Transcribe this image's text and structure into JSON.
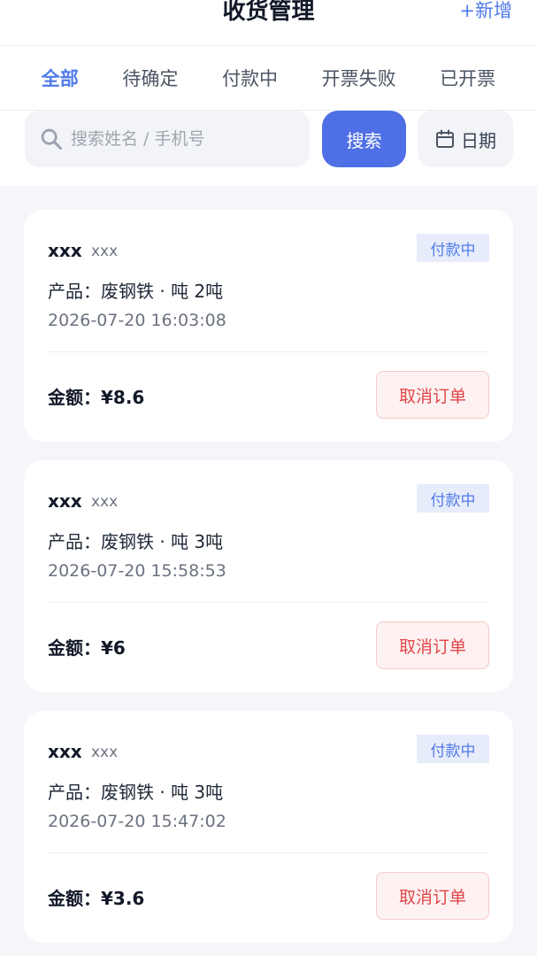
{
  "header": {
    "title": "收货管理",
    "add_label": "+新增"
  },
  "tabs": [
    {
      "label": "全部",
      "active": true
    },
    {
      "label": "待确定",
      "active": false
    },
    {
      "label": "付款中",
      "active": false
    },
    {
      "label": "开票失败",
      "active": false
    },
    {
      "label": "已开票",
      "active": false
    }
  ],
  "search": {
    "placeholder": "搜索姓名 / 手机号",
    "value": "",
    "button_label": "搜索",
    "date_label": "日期"
  },
  "colors": {
    "accent": "#4f6fe6",
    "link": "#4f7ae8",
    "danger": "#e0474a",
    "badge_bg": "#e7ecfb"
  },
  "orders": [
    {
      "name": "xxx",
      "sub": "xxx",
      "status": "付款中",
      "product": "产品：废钢铁 · 吨 2吨",
      "time": "2026-07-20 16:03:08",
      "amount": "金额：¥8.6",
      "cancel_label": "取消订单"
    },
    {
      "name": "xxx",
      "sub": "xxx",
      "status": "付款中",
      "product": "产品：废钢铁 · 吨 3吨",
      "time": "2026-07-20 15:58:53",
      "amount": "金额：¥6",
      "cancel_label": "取消订单"
    },
    {
      "name": "xxx",
      "sub": "xxx",
      "status": "付款中",
      "product": "产品：废钢铁 · 吨 3吨",
      "time": "2026-07-20 15:47:02",
      "amount": "金额：¥3.6",
      "cancel_label": "取消订单"
    }
  ]
}
